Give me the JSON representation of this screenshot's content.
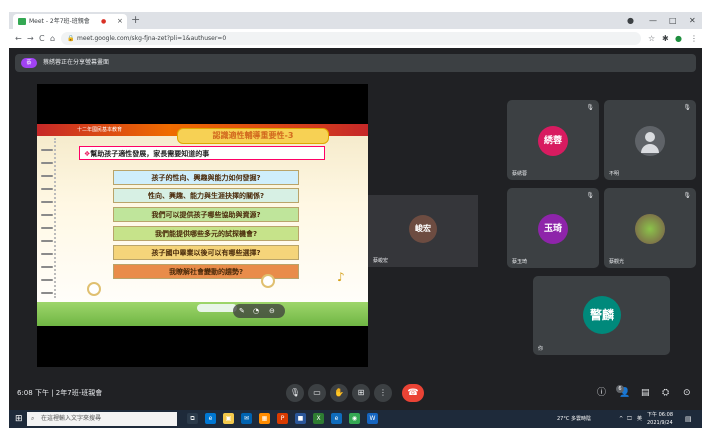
{
  "browser": {
    "tab_title": "Meet - 2年7班-班親會",
    "url": "meet.google.com/skg-fjna-zet?pli=1&authuser=0"
  },
  "meet": {
    "presenter_initials": "蔡",
    "present_banner": "蔡綉蓉正在分享螢幕畫面",
    "time": "6:08 下午",
    "separator": "|",
    "meeting_name": "2年7班-班親會"
  },
  "slide": {
    "top_caption": "十二年國民基本教育",
    "title": "認識適性輔導重要性-3",
    "subtitle_marker": "❖",
    "subtitle": "幫助孩子適性發展，家長需要知道的事",
    "lines": [
      {
        "text": "孩子的性向、興趣與能力如何發掘?",
        "color": "#cfeefb"
      },
      {
        "text": "性向、興趣、能力與生涯抉擇的關係?",
        "color": "#d7f0e4"
      },
      {
        "text": "我們可以提供孩子哪些協助與資源?",
        "color": "#bfe59b"
      },
      {
        "text": "我們能提供哪些多元的試探機會?",
        "color": "#c6e38a"
      },
      {
        "text": "孩子國中畢業以後可以有哪些選擇?",
        "color": "#f5d47a"
      },
      {
        "text": "我瞭解社會變動的趨勢?",
        "color": "#e98c4a"
      }
    ]
  },
  "tiles": [
    {
      "avatar": "綉蓉",
      "name": "蔡綉蓉",
      "color": "#d81b60"
    },
    {
      "avatar": "",
      "name": "不明",
      "color": "#5f6368"
    },
    {
      "avatar": "玉琦",
      "name": "蔡玉琦",
      "color": "#8e24aa"
    },
    {
      "avatar": "",
      "name": "蔡觀光",
      "color": "#795548"
    },
    {
      "avatar": "警麟",
      "name": "你",
      "color": "#00897b"
    }
  ],
  "presenter_small": {
    "avatar": "峻宏",
    "name": "蔡峻宏"
  },
  "participants_count": "6",
  "taskbar": {
    "search_placeholder": "在這裡輸入文字來搜尋",
    "weather": "27°C 多雲時陰",
    "ime": "英",
    "time": "下午 06:08",
    "date": "2021/9/24"
  },
  "colors": {
    "end_call": "#ea4335",
    "bg": "#202124",
    "tile": "#3c4043"
  }
}
